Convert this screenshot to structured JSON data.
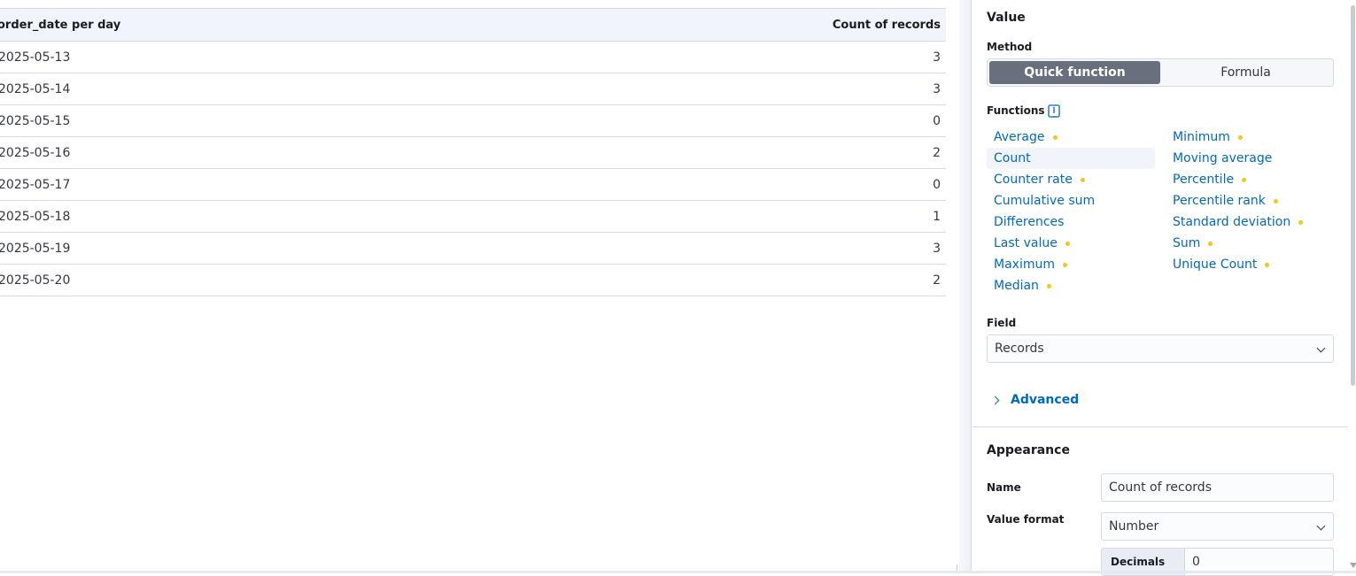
{
  "table": {
    "columns": [
      "order_date per day",
      "Count of records"
    ],
    "rows": [
      {
        "date": "2025-05-13",
        "count": "3"
      },
      {
        "date": "2025-05-14",
        "count": "3"
      },
      {
        "date": "2025-05-15",
        "count": "0"
      },
      {
        "date": "2025-05-16",
        "count": "2"
      },
      {
        "date": "2025-05-17",
        "count": "0"
      },
      {
        "date": "2025-05-18",
        "count": "1"
      },
      {
        "date": "2025-05-19",
        "count": "3"
      },
      {
        "date": "2025-05-20",
        "count": "2"
      }
    ]
  },
  "panel": {
    "value_title": "Value",
    "method_label": "Method",
    "method_options": [
      "Quick function",
      "Formula"
    ],
    "method_selected": "Quick function",
    "functions_label": "Functions",
    "functions_help_icon": "documentation-icon",
    "functions_left": [
      {
        "label": "Average",
        "dot": true
      },
      {
        "label": "Count",
        "dot": false,
        "active": true
      },
      {
        "label": "Counter rate",
        "dot": true
      },
      {
        "label": "Cumulative sum",
        "dot": false
      },
      {
        "label": "Differences",
        "dot": false
      },
      {
        "label": "Last value",
        "dot": true
      },
      {
        "label": "Maximum",
        "dot": true
      },
      {
        "label": "Median",
        "dot": true
      }
    ],
    "functions_right": [
      {
        "label": "Minimum",
        "dot": true
      },
      {
        "label": "Moving average",
        "dot": false
      },
      {
        "label": "Percentile",
        "dot": true
      },
      {
        "label": "Percentile rank",
        "dot": true
      },
      {
        "label": "Standard deviation",
        "dot": true
      },
      {
        "label": "Sum",
        "dot": true
      },
      {
        "label": "Unique Count",
        "dot": true
      }
    ],
    "field_label": "Field",
    "field_value": "Records",
    "advanced_label": "Advanced",
    "appearance_title": "Appearance",
    "name_label": "Name",
    "name_value": "Count of records",
    "value_format_label": "Value format",
    "value_format_value": "Number",
    "decimals_label": "Decimals",
    "decimals_value": "0"
  },
  "colors": {
    "link": "#006bb8",
    "selected_button": "#69707d",
    "dot": "#f5c518",
    "header_bg": "#f1f4fa"
  }
}
